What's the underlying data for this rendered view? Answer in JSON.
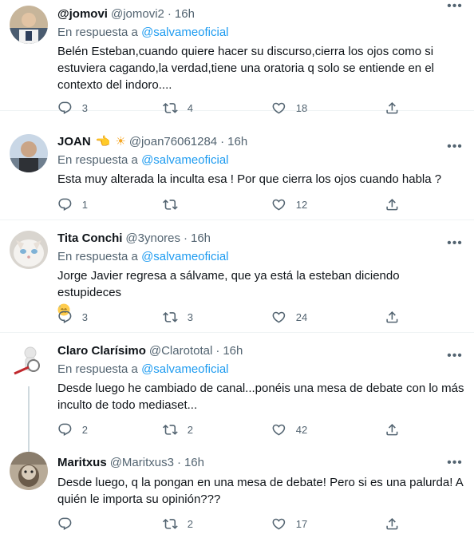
{
  "tweets": [
    {
      "name": "@jomovi",
      "handle": "@jomovi2",
      "time": "16h",
      "reply_prefix": "En respuesta a",
      "reply_to": "@salvameoficial",
      "text": "Belén Esteban,cuando quiere hacer su discurso,cierra los ojos como si estuviera cagando,la verdad,tiene una oratoria q solo se entiende en el contexto del indoro....",
      "replies": "3",
      "retweets": "4",
      "likes": "18"
    },
    {
      "name": "JOAN",
      "name_emojis": [
        "👈",
        "☀"
      ],
      "handle": "@joan76061284",
      "time": "16h",
      "reply_prefix": "En respuesta a",
      "reply_to": "@salvameoficial",
      "text": "Esta muy alterada la inculta esa ! Por que cierra los ojos cuando habla ?",
      "replies": "1",
      "retweets": "",
      "likes": "12"
    },
    {
      "name": "Tita Conchi",
      "handle": "@3ynores",
      "time": "16h",
      "reply_prefix": "En respuesta a",
      "reply_to": "@salvameoficial",
      "text": "Jorge Javier regresa a sálvame, que ya está la esteban diciendo estupideces",
      "replies": "3",
      "retweets": "3",
      "likes": "24"
    },
    {
      "name": "Claro Clarísimo",
      "handle": "@Clarototal",
      "time": "16h",
      "reply_prefix": "En respuesta a",
      "reply_to": "@salvameoficial",
      "text": "Desde luego he cambiado de canal...ponéis una mesa de debate con lo más inculto de todo mediaset...",
      "replies": "2",
      "retweets": "2",
      "likes": "42"
    },
    {
      "name": "Maritxus",
      "handle": "@Maritxus3",
      "time": "16h",
      "text": "Desde luego, q la pongan en una mesa de debate! Pero si es una palurda! A quién le importa su opinión???",
      "replies": "",
      "retweets": "2",
      "likes": "17"
    }
  ],
  "colors": {
    "text": "#0f1419",
    "secondary": "#536471",
    "link": "#1d9bf0",
    "divider": "#eff3f4"
  }
}
